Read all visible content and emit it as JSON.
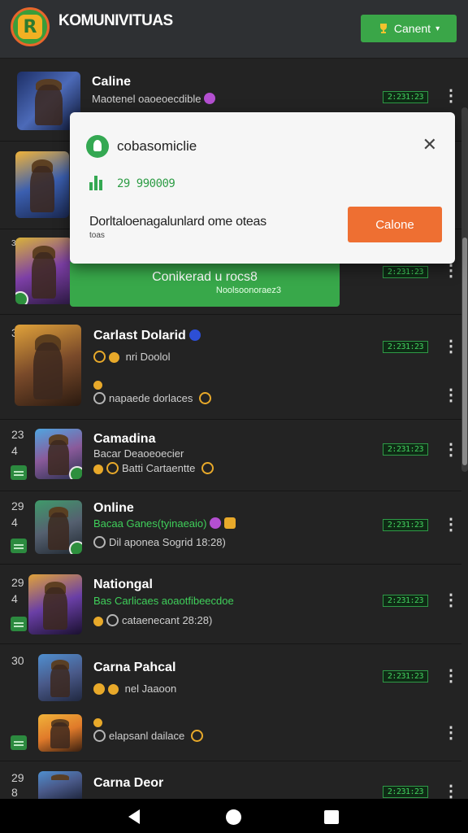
{
  "header": {
    "title": "KOMUNIVITUAS",
    "logo_letter": "R",
    "action_icon": "trophy-icon",
    "action_label": "Canent",
    "chevron": "▾"
  },
  "rows": [
    {
      "name": "Caline",
      "sub": "Maotenel oaoeoecdible",
      "tag": "2:231:23"
    },
    {
      "name": "",
      "sub": "",
      "tag": ""
    },
    {
      "name": "",
      "sub": "",
      "tag": "2:231:23"
    },
    {
      "name": "Carlast Dolarid",
      "sub1": "nri Doolol",
      "sub2": "napaede dorlaces",
      "tag": "2:231:23",
      "num": "30"
    },
    {
      "name": "Camadina",
      "sub1": "Bacar Deaoeoecier",
      "sub2": "Batti Cartaentte",
      "tag": "2:231:23",
      "num1": "23",
      "num2": "4"
    },
    {
      "name": "Online",
      "sub1": "Bacaa Ganes(tyinaeaio)",
      "sub2": "Dil aponea Sogrid 18:28)",
      "tag": "2:231:23",
      "num1": "29",
      "num2": "4"
    },
    {
      "name": "Nationgal",
      "sub1": "Bas Carlicaes aoaotfibeecdoe",
      "sub2": "cataenecant 28:28)",
      "tag": "2:231:23",
      "num1": "29",
      "num2": "4"
    },
    {
      "name": "Carna Pahcal",
      "sub1": "nel Jaaoon",
      "sub2": "elapsanl dailace",
      "tag": "2:231:23",
      "num": "30"
    },
    {
      "name": "Carna Deor",
      "tag": "2:231:23",
      "num1": "29",
      "num2": "8"
    }
  ],
  "overlay": {
    "title": "cobasomiclie",
    "stat": "29 990009",
    "message": "Dorltaloenagalunlard ome oteas",
    "message_small": "toas",
    "action": "Calone",
    "close": "✕"
  },
  "banner": {
    "title": "Conikerad u rocs8",
    "sub": "Noolsoonoraez3"
  },
  "colors": {
    "accent_green": "#38a84a",
    "accent_orange": "#ee6f32",
    "tag_green": "#43d35f"
  }
}
